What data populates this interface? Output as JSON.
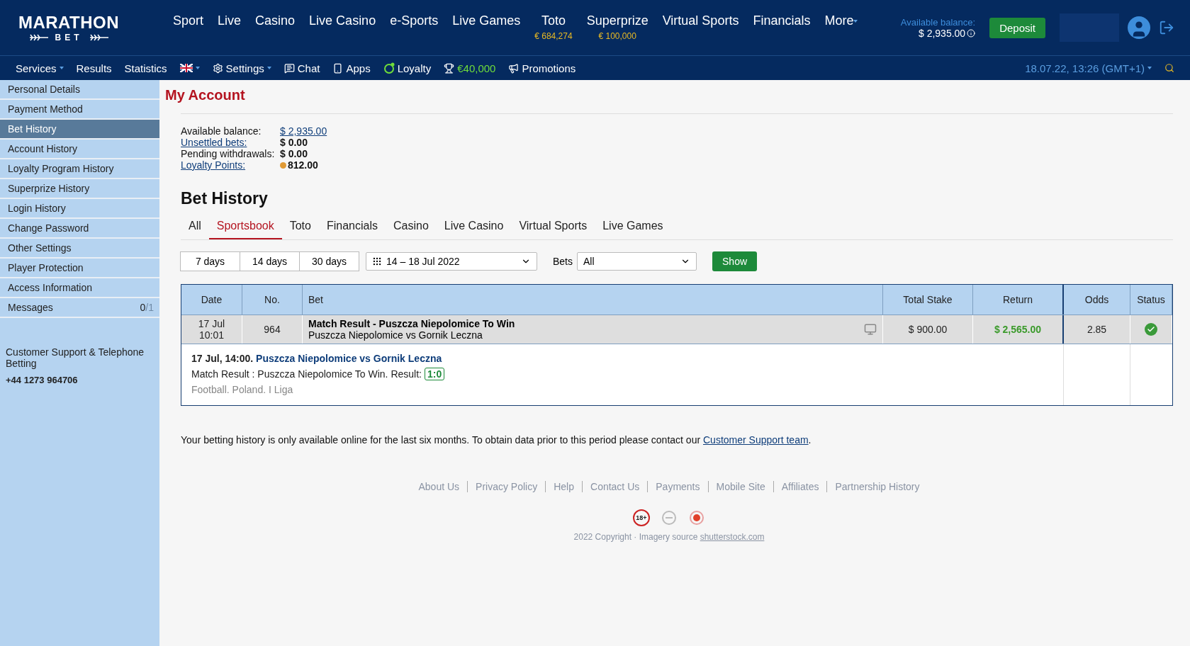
{
  "header": {
    "logo": {
      "top": "MARATHON",
      "bottom": "BET"
    },
    "nav": [
      {
        "label": "Sport"
      },
      {
        "label": "Live"
      },
      {
        "label": "Casino"
      },
      {
        "label": "Live Casino"
      },
      {
        "label": "e-Sports"
      },
      {
        "label": "Live Games"
      },
      {
        "label": "Toto",
        "sub": "€ 684,274"
      },
      {
        "label": "Superprize",
        "sub": "€ 100,000"
      },
      {
        "label": "Virtual Sports"
      },
      {
        "label": "Financials"
      }
    ],
    "more": "More",
    "balance_label": "Available balance:",
    "balance": "$ 2,935.00",
    "deposit": "Deposit"
  },
  "subnav": {
    "items": [
      {
        "label": "Services",
        "kind": "text",
        "dropdown": true,
        "highlight": false
      },
      {
        "label": "Results",
        "kind": "text",
        "dropdown": false,
        "highlight": false
      },
      {
        "label": "Statistics",
        "kind": "text",
        "dropdown": false,
        "highlight": false
      },
      {
        "kind": "language",
        "dropdown": true,
        "highlight": false
      },
      {
        "label": "Settings",
        "kind": "settings",
        "dropdown": true,
        "highlight": false
      },
      {
        "label": "Chat",
        "kind": "chat",
        "dropdown": false,
        "highlight": false
      },
      {
        "label": "Apps",
        "kind": "apps",
        "dropdown": false,
        "highlight": false
      },
      {
        "label": "Loyalty",
        "kind": "loyalty",
        "dropdown": false,
        "highlight": false
      },
      {
        "label": "€40,000",
        "kind": "jackpot",
        "dropdown": false,
        "highlight": true
      },
      {
        "label": "Promotions",
        "kind": "promotions",
        "dropdown": false,
        "highlight": false
      }
    ],
    "datetime": "18.07.22, 13:26 (GMT+1)"
  },
  "sidebar": {
    "items": [
      {
        "label": "Personal Details",
        "selected": false
      },
      {
        "label": "Payment Method",
        "selected": false
      },
      {
        "label": "Bet History",
        "selected": true
      },
      {
        "label": "Account History",
        "selected": false
      },
      {
        "label": "Loyalty Program History",
        "selected": false
      },
      {
        "label": "Superprize History",
        "selected": false
      },
      {
        "label": "Login History",
        "selected": false
      },
      {
        "label": "Change Password",
        "selected": false
      },
      {
        "label": "Other Settings",
        "selected": false
      },
      {
        "label": "Player Protection",
        "selected": false
      },
      {
        "label": "Access Information",
        "selected": false
      },
      {
        "label": "Messages",
        "selected": false,
        "count": "0",
        "total": "/1"
      }
    ],
    "support": "Customer Support & Telephone Betting",
    "phone": "+44 1273 964706"
  },
  "account": {
    "title": "My Account",
    "balances": [
      {
        "label": "Available balance:",
        "value": "$ 2,935.00",
        "label_link": false,
        "value_link": true,
        "coin": false
      },
      {
        "label": "Unsettled bets:",
        "value": "$ 0.00",
        "label_link": true,
        "value_link": false,
        "coin": false
      },
      {
        "label": "Pending withdrawals:",
        "value": "$ 0.00",
        "label_link": false,
        "value_link": false,
        "coin": false
      },
      {
        "label": "Loyalty Points:",
        "value": "812.00",
        "label_link": true,
        "value_link": false,
        "coin": true
      }
    ]
  },
  "bet_history": {
    "title": "Bet History",
    "tabs": [
      {
        "label": "All",
        "selected": false
      },
      {
        "label": "Sportsbook",
        "selected": true
      },
      {
        "label": "Toto",
        "selected": false
      },
      {
        "label": "Financials",
        "selected": false
      },
      {
        "label": "Casino",
        "selected": false
      },
      {
        "label": "Live Casino",
        "selected": false
      },
      {
        "label": "Virtual Sports",
        "selected": false
      },
      {
        "label": "Live Games",
        "selected": false
      }
    ],
    "periods": [
      "7 days",
      "14 days",
      "30 days"
    ],
    "date_range": "14 – 18 Jul 2022",
    "bets_label": "Bets",
    "bets_value": "All",
    "show": "Show",
    "table": {
      "columns": [
        "Date",
        "No.",
        "Bet",
        "Total Stake",
        "Return",
        "Odds",
        "Status"
      ],
      "rows": [
        {
          "date": "17 Jul",
          "time": "10:01",
          "number": "964",
          "bet": "Match Result - Puszcza Niepolomice To Win",
          "event": "Puszcza Niepolomice vs Gornik Leczna",
          "stake": "$ 900.00",
          "return": "$ 2,565.00",
          "odds": "2.85",
          "won": true,
          "detail": {
            "when": "17 Jul, 14:00.",
            "match": "Puszcza Niepolomice vs Gornik Leczna",
            "selection": "Match Result : Puszcza Niepolomice To Win. Result:",
            "result": "1:0",
            "league": "Football. Poland. I Liga"
          }
        }
      ]
    }
  },
  "notice": {
    "text": "Your betting history is only available online for the last six months. To obtain data prior to this period please contact our",
    "link": "Customer Support team",
    "end": "."
  },
  "footer": {
    "links": [
      "About Us",
      "Privacy Policy",
      "Help",
      "Contact Us",
      "Payments",
      "Mobile Site",
      "Affiliates",
      "Partnership History"
    ],
    "age_badge": "18+",
    "copyright": "2022 Copyright · Imagery source",
    "source_link": "shutterstock.com"
  }
}
